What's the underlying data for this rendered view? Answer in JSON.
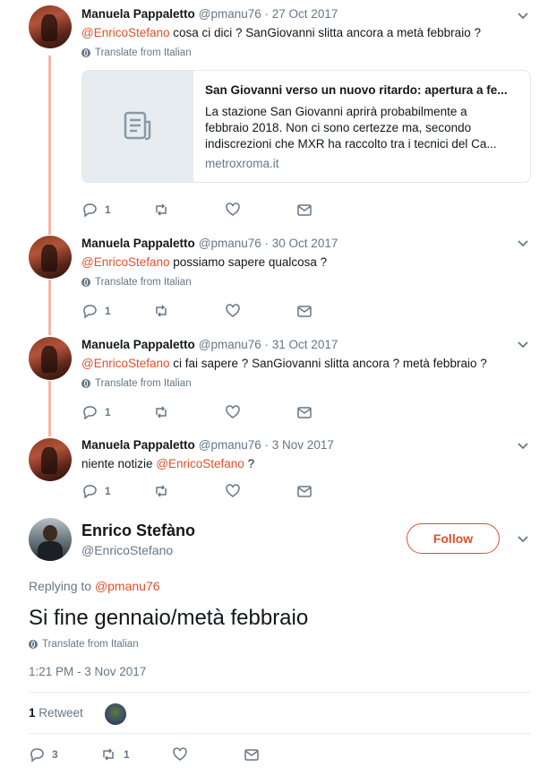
{
  "replies": [
    {
      "name": "Manuela Pappaletto",
      "handle": "@pmanu76",
      "date": "· 27 Oct 2017",
      "mention": "@EnricoStefano",
      "text": " cosa ci dici ? SanGiovanni slitta ancora a metà febbraio ?",
      "translate": "Translate from Italian",
      "card": {
        "title": "San Giovanni verso un nuovo ritardo: apertura a fe...",
        "description": "La stazione San Giovanni aprirà probabilmente a febbraio 2018. Non ci sono certezze ma, secondo indiscrezioni che MXR ha raccolto tra i tecnici del Ca...",
        "domain": "metroxroma.it"
      },
      "replies_count": "1"
    },
    {
      "name": "Manuela Pappaletto",
      "handle": "@pmanu76",
      "date": "· 30 Oct 2017",
      "mention": "@EnricoStefano",
      "text": " possiamo sapere qualcosa ?",
      "translate": "Translate from Italian",
      "replies_count": "1"
    },
    {
      "name": "Manuela Pappaletto",
      "handle": "@pmanu76",
      "date": "· 31 Oct 2017",
      "mention": "@EnricoStefano",
      "text": " ci fai sapere ? SanGiovanni slitta ancora ? metà febbraio ?",
      "translate": "Translate from Italian",
      "replies_count": "1"
    },
    {
      "name": "Manuela Pappaletto",
      "handle": "@pmanu76",
      "date": "· 3 Nov 2017",
      "pre_text": "niente notizie ",
      "mention": "@EnricoStefano",
      "text": " ?",
      "replies_count": "1"
    }
  ],
  "main": {
    "name": "Enrico Stefàno",
    "handle": "@EnricoStefano",
    "follow_label": "Follow",
    "replying_label": "Replying to ",
    "replying_handle": "@pmanu76",
    "text": "Si fine gennaio/metà febbraio",
    "translate": "Translate from Italian",
    "timestamp": "1:21 PM - 3 Nov 2017",
    "retweet_count": "1",
    "retweet_label": "Retweet",
    "reply_count": "3",
    "rt_count": "1"
  },
  "colors": {
    "accent": "#e0502a",
    "thread": "#f6b4a5",
    "muted": "#657786"
  }
}
